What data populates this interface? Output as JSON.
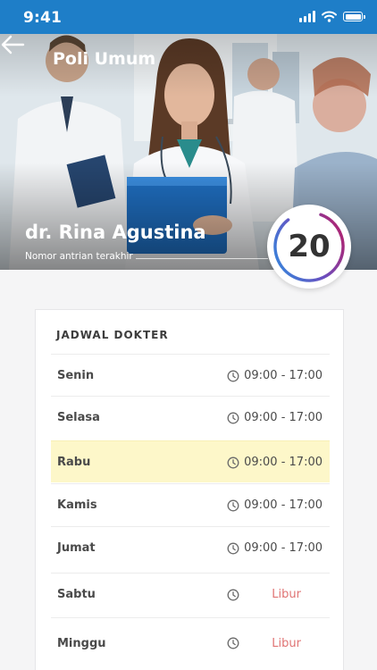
{
  "status_bar": {
    "time": "9:41"
  },
  "header": {
    "title": "Poli Umum",
    "doctor_name": "dr. Rina Agustina",
    "queue_caption": "Nomor antrian terakhir",
    "queue_number": "20"
  },
  "schedule": {
    "title": "JADWAL DOKTER",
    "rows": [
      {
        "day": "Senin",
        "time": "09:00 - 17:00"
      },
      {
        "day": "Selasa",
        "time": "09:00 - 17:00"
      },
      {
        "day": "Rabu",
        "time": "09:00 - 17:00"
      },
      {
        "day": "Kamis",
        "time": "09:00 - 17:00"
      },
      {
        "day": "Jumat",
        "time": "09:00 - 17:00"
      },
      {
        "day": "Sabtu",
        "time": "Libur"
      },
      {
        "day": "Minggu",
        "time": "Libur"
      }
    ]
  },
  "colors": {
    "status_bar": "#1e7ec8",
    "highlight_row": "#fdf7c9",
    "day_off_text": "#e07474",
    "ring_gradient_start": "#2d8fe0",
    "ring_gradient_end": "#c2185b"
  },
  "icons": [
    "back-arrow-icon",
    "signal-icon",
    "wifi-icon",
    "battery-icon",
    "clock-icon"
  ]
}
